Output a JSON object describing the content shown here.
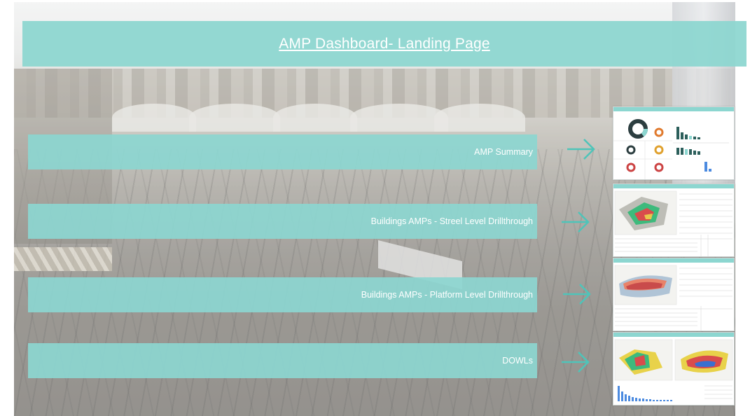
{
  "title": "AMP Dashboard- Landing Page",
  "buttons": [
    {
      "label": "AMP Summary"
    },
    {
      "label": "Buildings AMPs - Streel Level Drillthrough"
    },
    {
      "label": "Buildings AMPs - Platform Level Drillthrough"
    },
    {
      "label": "DOWLs"
    }
  ],
  "colors": {
    "accent": "#8cd6d0",
    "arrow": "#4fc4b9"
  },
  "icons": [
    "arrow-right-icon"
  ]
}
